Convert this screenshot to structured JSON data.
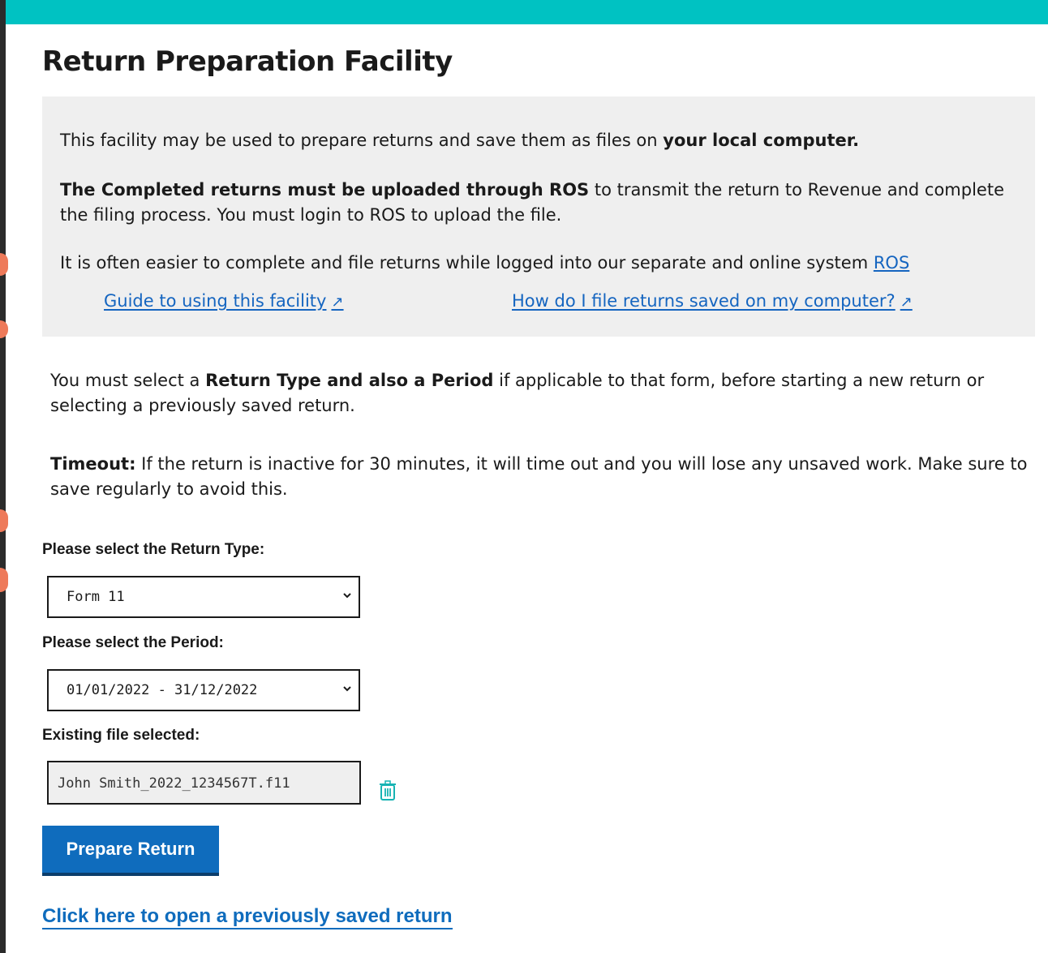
{
  "page": {
    "title": "Return Preparation Facility"
  },
  "info": {
    "p1_text": "This facility may be used to prepare returns and save them as files on ",
    "p1_bold": "your local computer.",
    "p2_bold": "The Completed returns must be uploaded through ROS",
    "p2_text": " to transmit the return to Revenue and complete the filing process. You must login to ROS to upload the file.",
    "p3_text": "It is often easier to complete and file returns while logged into our separate and online system ",
    "p3_link": "ROS",
    "guide_link": "Guide to using this facility",
    "file_link": "How do I file returns saved on my computer?",
    "external_arrow": "↗"
  },
  "instructions": {
    "select_pre": "You must select a ",
    "select_bold": "Return Type and also a Period",
    "select_post": " if applicable to that form, before starting a new return or selecting a previously saved return.",
    "timeout_bold": "Timeout:",
    "timeout_text": " If the return is inactive for 30 minutes, it will time out and you will lose any unsaved work. Make sure to save regularly to avoid this."
  },
  "form": {
    "return_type_label": "Please select the Return Type:",
    "return_type_value": "Form 11",
    "period_label": "Please select the Period:",
    "period_value": "01/01/2022 - 31/12/2022",
    "file_label": "Existing file selected:",
    "file_value": "John Smith_2022_1234567T.f11",
    "prepare_button": "Prepare Return",
    "open_saved_link": "Click here to open a previously saved return"
  },
  "colors": {
    "accent": "#00c2c2",
    "link": "#1565c0",
    "button": "#0f6cbd",
    "trash_icon": "#17b3b3"
  }
}
